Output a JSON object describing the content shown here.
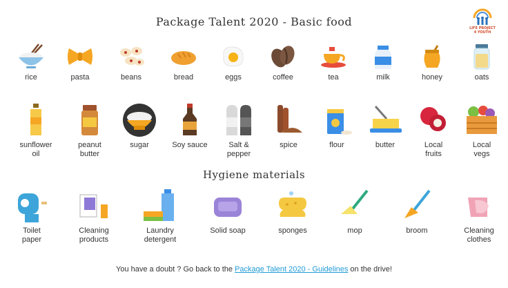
{
  "title": "Package Talent 2020 - Basic food",
  "logo": {
    "line1": "LIFE PROJECT",
    "line2": "4 YOUTH"
  },
  "food_row1": [
    {
      "label": "rice",
      "icon": "rice-bowl-icon"
    },
    {
      "label": "pasta",
      "icon": "pasta-icon"
    },
    {
      "label": "beans",
      "icon": "beans-icon"
    },
    {
      "label": "bread",
      "icon": "bread-icon"
    },
    {
      "label": "eggs",
      "icon": "egg-icon"
    },
    {
      "label": "coffee",
      "icon": "coffee-bean-icon"
    },
    {
      "label": "tea",
      "icon": "tea-cup-icon"
    },
    {
      "label": "milk",
      "icon": "milk-carton-icon"
    },
    {
      "label": "honey",
      "icon": "honey-jar-icon"
    },
    {
      "label": "oats",
      "icon": "oats-jar-icon"
    }
  ],
  "food_row2": [
    {
      "label": "sunflower\noil",
      "icon": "oil-bottle-icon"
    },
    {
      "label": "peanut\nbutter",
      "icon": "peanut-butter-jar-icon"
    },
    {
      "label": "sugar",
      "icon": "sugar-bowl-icon"
    },
    {
      "label": "Soy sauce",
      "icon": "soy-sauce-bottle-icon"
    },
    {
      "label": "Salt &\npepper",
      "icon": "salt-pepper-icon"
    },
    {
      "label": "spice",
      "icon": "cinnamon-icon"
    },
    {
      "label": "flour",
      "icon": "flour-icon"
    },
    {
      "label": "butter",
      "icon": "butter-icon"
    },
    {
      "label": "Local\nfruits",
      "icon": "rambutan-icon"
    },
    {
      "label": "Local\nvegs",
      "icon": "vegetable-crate-icon"
    }
  ],
  "hygiene_title": "Hygiene materials",
  "hygiene_row": [
    {
      "label": "Toilet\npaper",
      "icon": "toilet-paper-icon"
    },
    {
      "label": "Cleaning\nproducts",
      "icon": "cleaning-products-icon"
    },
    {
      "label": "Laundry\ndetergent",
      "icon": "detergent-bottle-icon"
    },
    {
      "label": "Solid soap",
      "icon": "soap-bar-icon"
    },
    {
      "label": "sponges",
      "icon": "sponge-icon"
    },
    {
      "label": "mop",
      "icon": "mop-icon"
    },
    {
      "label": "broom",
      "icon": "broom-icon"
    },
    {
      "label": "Cleaning\nclothes",
      "icon": "cleaning-cloth-icon"
    }
  ],
  "footer": {
    "before": "You have a doubt ? Go back to the ",
    "link": "Package Talent 2020 - Guidelines",
    "after": " on the drive!"
  }
}
